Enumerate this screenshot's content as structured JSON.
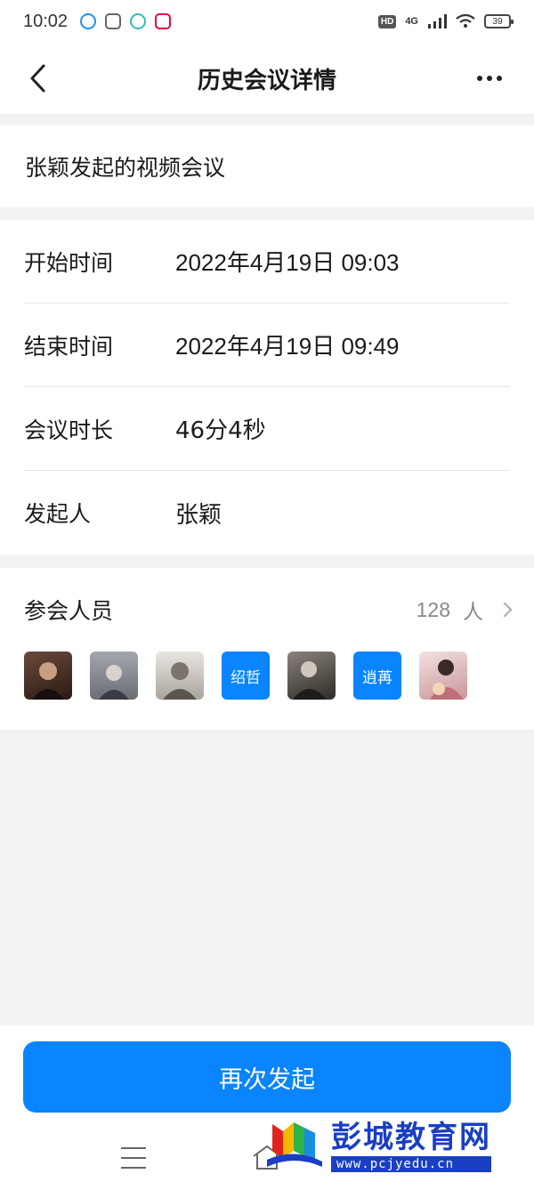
{
  "status_bar": {
    "time": "10:02",
    "hd": "HD",
    "network": "4G",
    "battery": "39"
  },
  "header": {
    "title": "历史会议详情"
  },
  "meeting": {
    "name": "张颖发起的视频会议"
  },
  "info": [
    {
      "label": "开始时间",
      "value": "2022年4月19日  09:03"
    },
    {
      "label": "结束时间",
      "value": "2022年4月19日  09:49"
    },
    {
      "label": "会议时长",
      "value": "46分4秒"
    },
    {
      "label": "发起人",
      "value": "张颖"
    }
  ],
  "participants": {
    "title": "参会人员",
    "count": "128",
    "unit": "人",
    "avatars": [
      {
        "type": "photo",
        "color": "#3a2a24"
      },
      {
        "type": "photo",
        "color": "#8a8c94"
      },
      {
        "type": "photo",
        "color": "#c9c4bd"
      },
      {
        "type": "text",
        "text": "绍哲"
      },
      {
        "type": "photo",
        "color": "#4a4640"
      },
      {
        "type": "text",
        "text": "逍苒"
      },
      {
        "type": "photo",
        "color": "#d9a9a9"
      }
    ]
  },
  "actions": {
    "restart": "再次发起"
  },
  "watermark": {
    "title": "彭城教育网",
    "url": "www.pcjyedu.cn"
  },
  "colors": {
    "accent": "#0a84ff",
    "background": "#f2f2f5"
  }
}
